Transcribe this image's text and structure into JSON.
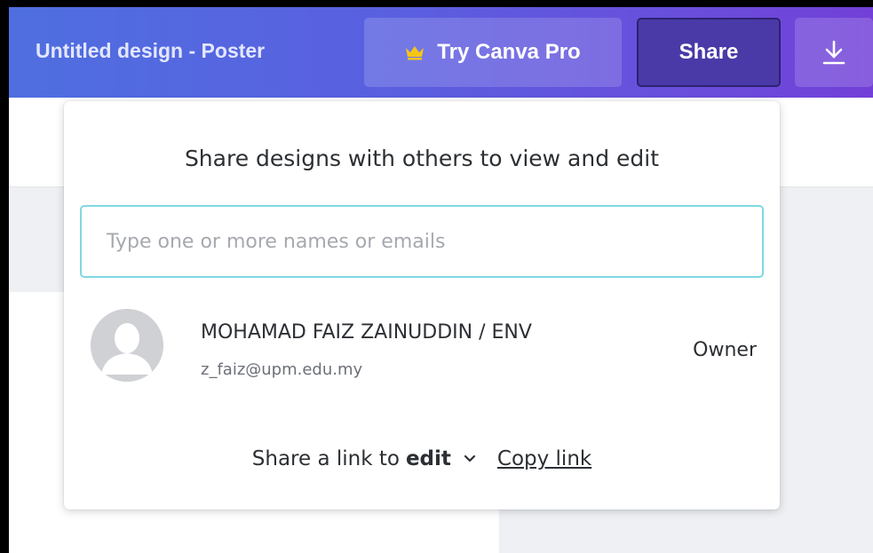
{
  "header": {
    "doc_title": "Untitled design - Poster",
    "pro_label": "Try Canva Pro",
    "share_label": "Share",
    "download_icon": "download-icon",
    "crown_color": "#f5c518"
  },
  "share_panel": {
    "heading": "Share designs with others to view and edit",
    "invite_placeholder": "Type one or more names or emails",
    "members": [
      {
        "name": "MOHAMAD FAIZ ZAINUDDIN / ENV",
        "email": "z_faiz@upm.edu.my",
        "role": "Owner"
      }
    ],
    "link_prefix": "Share a link to",
    "link_mode": "edit",
    "copy_link_label": "Copy link"
  }
}
